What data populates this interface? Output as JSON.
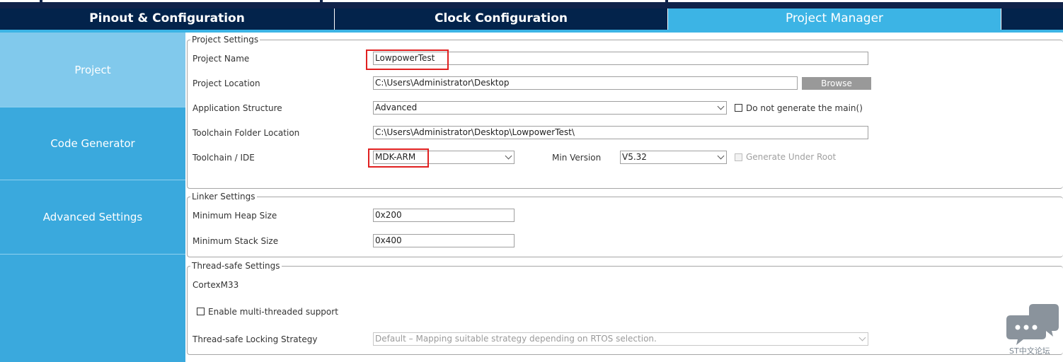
{
  "tabs": [
    {
      "label": "Pinout & Configuration",
      "active": false
    },
    {
      "label": "Clock Configuration",
      "active": false
    },
    {
      "label": "Project Manager",
      "active": true
    }
  ],
  "sidebar": {
    "items": [
      {
        "label": "Project",
        "active": true
      },
      {
        "label": "Code Generator",
        "active": false
      },
      {
        "label": "Advanced Settings",
        "active": false
      }
    ]
  },
  "project_settings": {
    "legend": "Project Settings",
    "project_name": {
      "label": "Project Name",
      "value": "LowpowerTest"
    },
    "project_location": {
      "label": "Project Location",
      "value": "C:\\Users\\Administrator\\Desktop",
      "browse_label": "Browse"
    },
    "application_structure": {
      "label": "Application Structure",
      "value": "Advanced",
      "checkbox_label": "Do not generate the main()",
      "checked": false
    },
    "toolchain_folder": {
      "label": "Toolchain Folder Location",
      "value": "C:\\Users\\Administrator\\Desktop\\LowpowerTest\\"
    },
    "toolchain_ide": {
      "label": "Toolchain / IDE",
      "value": "MDK-ARM",
      "min_version_label": "Min Version",
      "min_version_value": "V5.32",
      "generate_under_root_label": "Generate Under Root",
      "generate_under_root_checked": false
    }
  },
  "linker_settings": {
    "legend": "Linker Settings",
    "heap": {
      "label": "Minimum Heap Size",
      "value": "0x200"
    },
    "stack": {
      "label": "Minimum Stack Size",
      "value": "0x400"
    }
  },
  "thread_safe": {
    "legend": "Thread-safe Settings",
    "core": "CortexM33",
    "multithread_label": "Enable multi-threaded support",
    "multithread_checked": false,
    "locking_label": "Thread-safe Locking Strategy",
    "locking_value": "Default  –  Mapping suitable strategy depending on RTOS selection."
  },
  "watermark": {
    "text": "ST中文论坛",
    "icon": "chat-bubbles-icon"
  },
  "colors": {
    "accent": "#3cb4e5",
    "header": "#03234b",
    "sidebar": "#3aa9dd",
    "sidebar_active": "#81c9ec",
    "highlight": "#e02020"
  }
}
